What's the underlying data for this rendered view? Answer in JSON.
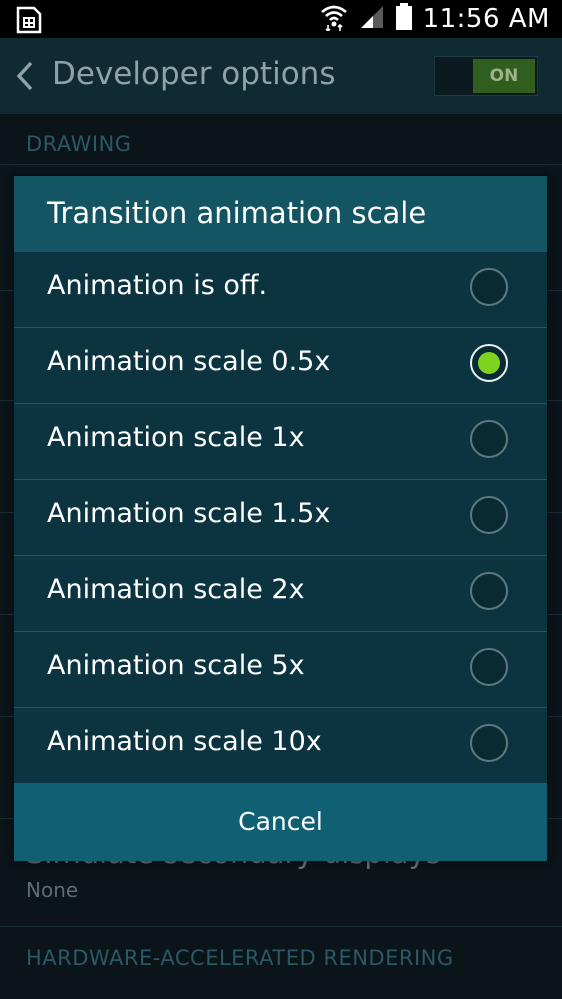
{
  "status_bar": {
    "time": "11:56 AM",
    "left_icon": "sim-card-icon",
    "icons": [
      "wifi-icon",
      "signal-icon",
      "battery-icon"
    ]
  },
  "action_bar": {
    "title": "Developer options",
    "back_icon": "back-chevron-icon",
    "master_switch": {
      "label": "ON",
      "state": true
    }
  },
  "background": {
    "section_drawing": "DRAWING",
    "visible_item": {
      "title": "Simulate secondary displays",
      "summary": "None"
    },
    "section_hardware": "HARDWARE-ACCELERATED RENDERING"
  },
  "dialog": {
    "title": "Transition animation scale",
    "options": [
      {
        "label": "Animation is off.",
        "selected": false
      },
      {
        "label": "Animation scale 0.5x",
        "selected": true
      },
      {
        "label": "Animation scale 1x",
        "selected": false
      },
      {
        "label": "Animation scale 1.5x",
        "selected": false
      },
      {
        "label": "Animation scale 2x",
        "selected": false
      },
      {
        "label": "Animation scale 5x",
        "selected": false
      },
      {
        "label": "Animation scale 10x",
        "selected": false
      }
    ],
    "cancel_label": "Cancel"
  },
  "colors": {
    "accent_green": "#7ed321",
    "dialog_title_bg": "#145563",
    "dialog_body_bg": "#0b3440",
    "dialog_footer_bg": "#0f6072"
  }
}
